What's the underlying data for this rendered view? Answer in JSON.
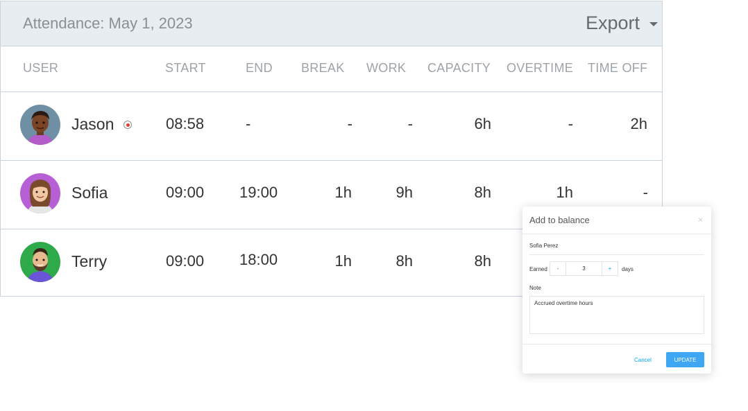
{
  "header": {
    "title": "Attendance: May 1, 2023",
    "export_label": "Export"
  },
  "columns": [
    "USER",
    "START",
    "END",
    "BREAK",
    "WORK",
    "CAPACITY",
    "OVERTIME",
    "TIME OFF"
  ],
  "rows": [
    {
      "name": "Jason",
      "start": "08:58",
      "end": "-",
      "break": "-",
      "work": "-",
      "capacity": "6h",
      "overtime": "-",
      "time_off": "2h"
    },
    {
      "name": "Sofia",
      "start": "09:00",
      "end": "19:00",
      "break": "1h",
      "work": "9h",
      "capacity": "8h",
      "overtime": "1h",
      "time_off": "-"
    },
    {
      "name": "Terry",
      "start": "09:00",
      "end": "18:00",
      "break": "1h",
      "work": "8h",
      "capacity": "8h",
      "overtime": "",
      "time_off": ""
    }
  ],
  "dialog": {
    "title": "Add to balance",
    "close_icon": "×",
    "user": "Sofia Perez",
    "earned_label": "Earned",
    "minus": "-",
    "value": "3",
    "plus": "+",
    "unit": "days",
    "note_label": "Note",
    "note_value": "Accrued overtime hours",
    "cancel_label": "Cancel",
    "update_label": "UPDATE"
  },
  "colors": {
    "accent": "#3ea6f2",
    "link": "#03a9f4",
    "recording": "#e53935",
    "header_bg": "#e8edf1"
  }
}
